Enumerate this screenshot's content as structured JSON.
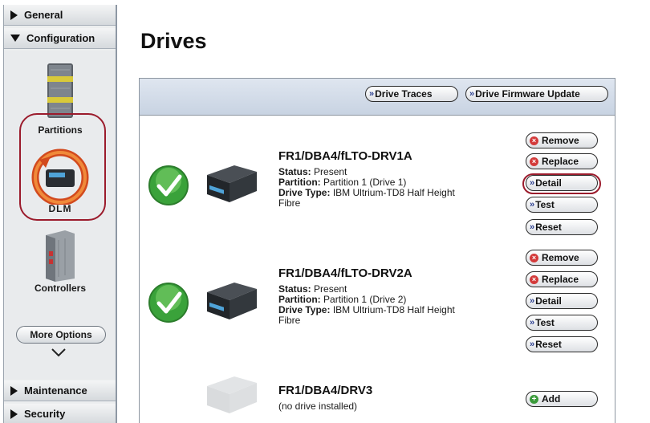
{
  "sidebar": {
    "sections": {
      "general": "General",
      "configuration": "Configuration",
      "maintenance": "Maintenance",
      "security": "Security"
    },
    "items": [
      {
        "label": "Partitions"
      },
      {
        "label": "DLM"
      },
      {
        "label": "Controllers"
      }
    ],
    "more_options": "More Options"
  },
  "page": {
    "title": "Drives"
  },
  "toolbar": {
    "drive_traces": "Drive Traces",
    "drive_firmware_update": "Drive Firmware Update"
  },
  "drives": [
    {
      "name": "FR1/DBA4/fLTO-DRV1A",
      "status_label": "Status:",
      "status": "Present",
      "partition_label": "Partition:",
      "partition": "Partition 1 (Drive 1)",
      "type_label": "Drive Type:",
      "type": "IBM Ultrium-TD8 Half Height",
      "type_cont": "Fibre",
      "actions": {
        "remove": "Remove",
        "replace": "Replace",
        "detail": "Detail",
        "test": "Test",
        "reset": "Reset"
      }
    },
    {
      "name": "FR1/DBA4/fLTO-DRV2A",
      "status_label": "Status:",
      "status": "Present",
      "partition_label": "Partition:",
      "partition": "Partition 1 (Drive 2)",
      "type_label": "Drive Type:",
      "type": "IBM Ultrium-TD8 Half Height",
      "type_cont": "Fibre",
      "actions": {
        "remove": "Remove",
        "replace": "Replace",
        "detail": "Detail",
        "test": "Test",
        "reset": "Reset"
      }
    },
    {
      "name": "FR1/DBA4/DRV3",
      "note": "(no drive installed)",
      "actions": {
        "add": "Add"
      }
    }
  ],
  "colors": {
    "highlight_ring": "#9b1b2c",
    "panel_header": "#c8d3e2",
    "check_green": "#3aa23a"
  }
}
